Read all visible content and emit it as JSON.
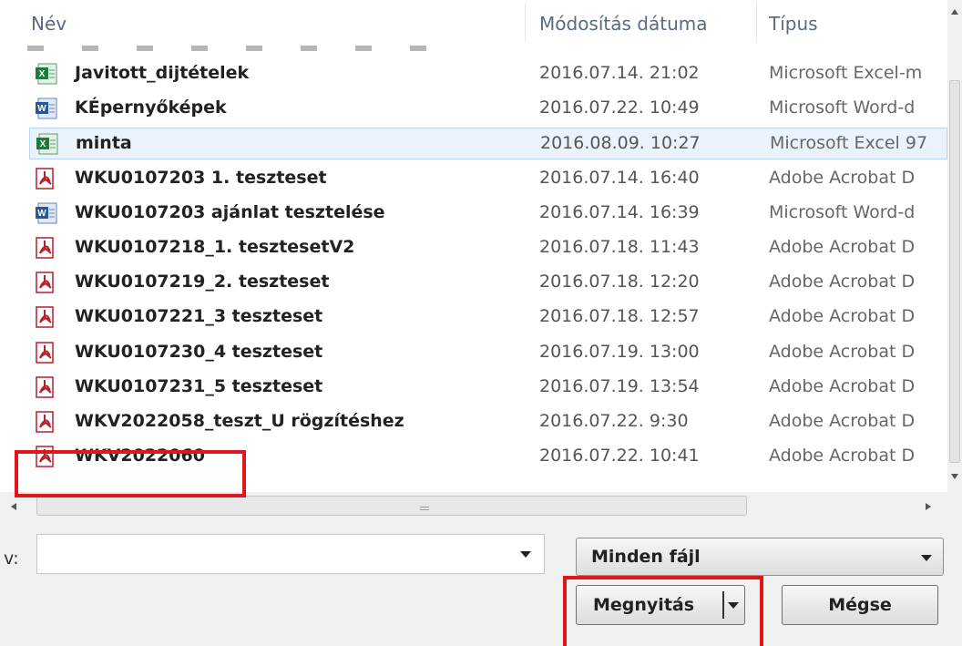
{
  "columns": {
    "name": "Név",
    "modified": "Módosítás dátuma",
    "type": "Típus"
  },
  "files": [
    {
      "name": "Javitott_dijtételek",
      "date": "2016.07.14. 21:02",
      "type": "Microsoft Excel-m",
      "icon": "excel-icon",
      "selected": false
    },
    {
      "name": "KÉpernyőképek",
      "date": "2016.07.22. 10:49",
      "type": "Microsoft Word-d",
      "icon": "word-icon",
      "selected": false
    },
    {
      "name": "minta",
      "date": "2016.08.09. 10:27",
      "type": "Microsoft Excel 97",
      "icon": "excel-icon",
      "selected": true
    },
    {
      "name": "WKU0107203 1. teszteset",
      "date": "2016.07.14. 16:40",
      "type": "Adobe Acrobat D",
      "icon": "pdf-icon",
      "selected": false
    },
    {
      "name": "WKU0107203 ajánlat tesztelése",
      "date": "2016.07.14. 16:39",
      "type": "Microsoft Word-d",
      "icon": "word-icon",
      "selected": false
    },
    {
      "name": "WKU0107218_1. tesztesetV2",
      "date": "2016.07.18. 11:43",
      "type": "Adobe Acrobat D",
      "icon": "pdf-icon",
      "selected": false
    },
    {
      "name": "WKU0107219_2. teszteset",
      "date": "2016.07.18. 12:20",
      "type": "Adobe Acrobat D",
      "icon": "pdf-icon",
      "selected": false
    },
    {
      "name": "WKU0107221_3 teszteset",
      "date": "2016.07.18. 12:57",
      "type": "Adobe Acrobat D",
      "icon": "pdf-icon",
      "selected": false
    },
    {
      "name": "WKU0107230_4 teszteset",
      "date": "2016.07.19. 13:00",
      "type": "Adobe Acrobat D",
      "icon": "pdf-icon",
      "selected": false
    },
    {
      "name": "WKU0107231_5 teszteset",
      "date": "2016.07.19. 13:54",
      "type": "Adobe Acrobat D",
      "icon": "pdf-icon",
      "selected": false
    },
    {
      "name": "WKV2022058_teszt_U rögzítéshez",
      "date": "2016.07.22. 9:30",
      "type": "Adobe Acrobat D",
      "icon": "pdf-icon",
      "selected": false
    },
    {
      "name": "WKV2022060",
      "date": "2016.07.22. 10:41",
      "type": "Adobe Acrobat D",
      "icon": "pdf-icon",
      "selected": false
    }
  ],
  "filename": {
    "label": "v:",
    "value": ""
  },
  "filter": {
    "selected": "Minden fájl"
  },
  "buttons": {
    "open": "Megnyitás",
    "cancel": "Mégse"
  },
  "colors": {
    "highlight": "#e0161c",
    "selected_row": "#eaf3fc",
    "pdf": "#b5202a",
    "word": "#2b5797",
    "excel": "#1d7a3a"
  }
}
